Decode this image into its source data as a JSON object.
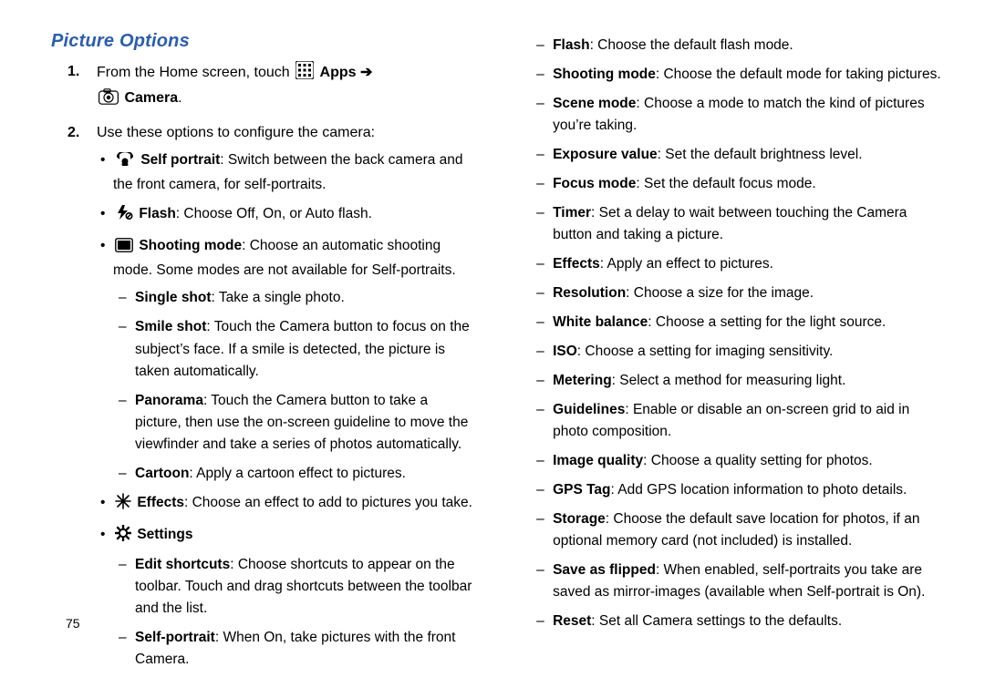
{
  "heading": "Picture Options",
  "page_number": "75",
  "step1": {
    "prefix_num": "1.",
    "text_before": "From the Home screen, touch ",
    "apps_label": "Apps",
    "arrow": "➔",
    "camera_label": "Camera",
    "period": "."
  },
  "step2": {
    "prefix_num": "2.",
    "lead": "Use these options to configure the camera:"
  },
  "self_portrait": {
    "label": "Self portrait",
    "text": ": Switch between the back camera and the front camera, for self-portraits."
  },
  "flash_opt": {
    "label": "Flash",
    "text": ": Choose Off, On, or Auto flash."
  },
  "shooting_mode": {
    "label": "Shooting mode",
    "text": ": Choose an automatic shooting mode. Some modes are not available for Self-portraits."
  },
  "single_shot": {
    "label": "Single shot",
    "text": ": Take a single photo."
  },
  "smile_shot": {
    "label": "Smile shot",
    "text": ": Touch the Camera button to focus on the subject’s face. If a smile is detected, the picture is taken automatically."
  },
  "panorama": {
    "label": "Panorama",
    "text": ": Touch the Camera button to take a picture, then use the on-screen guideline to move the viewfinder and take a series of photos automatically."
  },
  "cartoon": {
    "label": "Cartoon",
    "text": ": Apply a cartoon effect to pictures."
  },
  "effects_opt": {
    "label": "Effects",
    "text": ": Choose an effect to add to pictures you take."
  },
  "settings_label": "Settings",
  "edit_shortcuts": {
    "label": "Edit shortcuts",
    "text": ": Choose shortcuts to appear on the toolbar. Touch and drag shortcuts between the toolbar and the list."
  },
  "self_portrait2": {
    "label": "Self-portrait",
    "text": ": When On, take pictures with the front Camera."
  },
  "right": {
    "flash": {
      "label": "Flash",
      "text": ": Choose the default flash mode."
    },
    "shooting": {
      "label": "Shooting mode",
      "text": ": Choose the default mode for taking pictures."
    },
    "scene": {
      "label": "Scene mode",
      "text": ": Choose a mode to match the kind of pictures you’re taking."
    },
    "exposure": {
      "label": "Exposure value",
      "text": ": Set the default brightness level."
    },
    "focus": {
      "label": "Focus mode",
      "text": ": Set the default focus mode."
    },
    "timer": {
      "label": "Timer",
      "text": ": Set a delay to wait between touching the Camera button and taking a picture."
    },
    "effects": {
      "label": "Effects",
      "text": ": Apply an effect to pictures."
    },
    "resolution": {
      "label": "Resolution",
      "text": ": Choose a size for the image."
    },
    "whitebalance": {
      "label": "White balance",
      "text": ": Choose a setting for the light source."
    },
    "iso": {
      "label": "ISO",
      "text": ": Choose a setting for imaging sensitivity."
    },
    "metering": {
      "label": "Metering",
      "text": ": Select a method for measuring light."
    },
    "guidelines": {
      "label": "Guidelines",
      "text": ": Enable or disable an on-screen grid to aid in photo composition."
    },
    "image_quality": {
      "label": "Image quality",
      "text": ": Choose a quality setting for photos."
    },
    "gps_tag": {
      "label": "GPS Tag",
      "text": ": Add GPS location information to photo details."
    },
    "storage": {
      "label": "Storage",
      "text": ": Choose the default save location for photos, if an optional memory card (not included) is installed."
    },
    "save_flipped": {
      "label": "Save as flipped",
      "text": ": When enabled, self-portraits you take are saved as mirror-images (available when Self-portrait is On)."
    },
    "reset": {
      "label": "Reset",
      "text": ": Set all Camera settings to the defaults."
    }
  }
}
